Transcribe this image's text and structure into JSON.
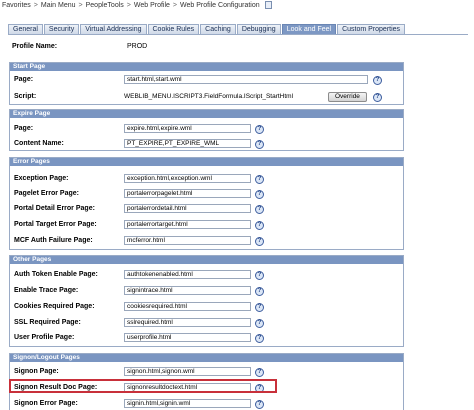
{
  "breadcrumb": {
    "items": [
      "Favorites",
      "Main Menu",
      "PeopleTools",
      "Web Profile",
      "Web Profile Configuration"
    ],
    "separator": ">"
  },
  "tabs": [
    {
      "label": "General"
    },
    {
      "label": "Security"
    },
    {
      "label": "Virtual Addressing"
    },
    {
      "label": "Cookie Rules"
    },
    {
      "label": "Caching"
    },
    {
      "label": "Debugging"
    },
    {
      "label": "Look and Feel",
      "active": true
    },
    {
      "label": "Custom Properties"
    }
  ],
  "profile": {
    "label": "Profile Name:",
    "value": "PROD"
  },
  "sections": {
    "start_page": {
      "title": "Start Page",
      "page": {
        "label": "Page:",
        "value": "start.html,start.wml"
      },
      "script": {
        "label": "Script:",
        "value": "WEBLIB_MENU.ISCRIPT3.FieldFormula.IScript_StartHtml",
        "button": "Override"
      }
    },
    "expire_page": {
      "title": "Expire Page",
      "page": {
        "label": "Page:",
        "value": "expire.html,expire.wml"
      },
      "content_name": {
        "label": "Content Name:",
        "value": "PT_EXPIRE,PT_EXPIRE_WML"
      }
    },
    "error_pages": {
      "title": "Error Pages",
      "rows": [
        {
          "label": "Exception Page:",
          "value": "exception.html,exception.wml"
        },
        {
          "label": "Pagelet Error Page:",
          "value": "portalerrorpagelet.html"
        },
        {
          "label": "Portal Detail Error Page:",
          "value": "portalerrordetail.html"
        },
        {
          "label": "Portal Target Error Page:",
          "value": "portalerrortarget.html"
        },
        {
          "label": "MCF Auth Failure Page:",
          "value": "mcferror.html"
        }
      ]
    },
    "other_pages": {
      "title": "Other Pages",
      "rows": [
        {
          "label": "Auth Token Enable Page:",
          "value": "authtokenenabled.html"
        },
        {
          "label": "Enable Trace Page:",
          "value": "signintrace.html"
        },
        {
          "label": "Cookies Required Page:",
          "value": "cookiesrequired.html"
        },
        {
          "label": "SSL Required Page:",
          "value": "sslrequired.html"
        },
        {
          "label": "User Profile Page:",
          "value": "userprofile.html"
        }
      ]
    },
    "signon_pages": {
      "title": "Signon/Logout Pages",
      "rows": [
        {
          "label": "Signon Page:",
          "value": "signon.html,signon.wml"
        },
        {
          "label": "Signon Result Doc Page:",
          "value": "signonresultdoctext.html"
        },
        {
          "label": "Signon Error Page:",
          "value": "signin.html,signin.wml"
        }
      ]
    }
  },
  "help_glyph": "?",
  "colors": {
    "section_header": "#7a95c1",
    "active_tab": "#7d98c4",
    "highlight": "#c8303a"
  }
}
